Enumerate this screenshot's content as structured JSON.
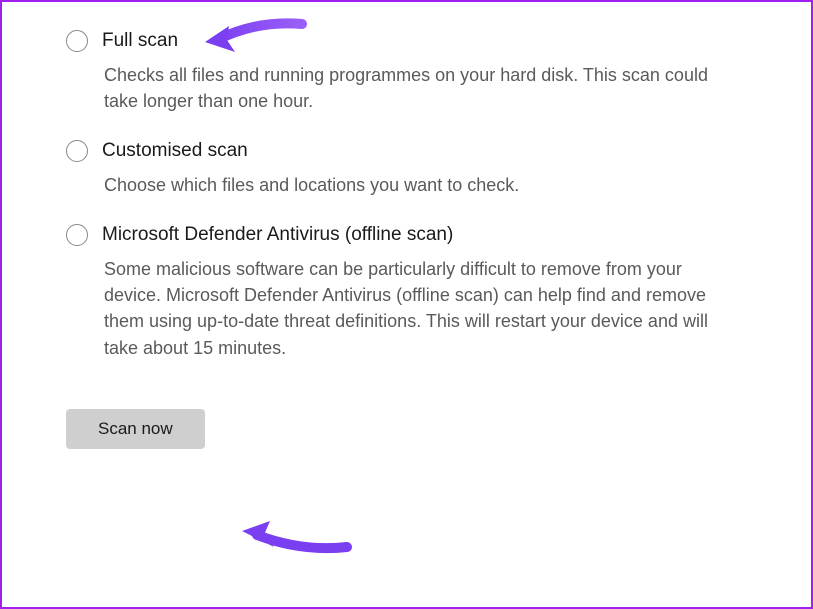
{
  "options": [
    {
      "title": "Full scan",
      "description": "Checks all files and running programmes on your hard disk. This scan could take longer than one hour."
    },
    {
      "title": "Customised scan",
      "description": "Choose which files and locations you want to check."
    },
    {
      "title": "Microsoft Defender Antivirus (offline scan)",
      "description": "Some malicious software can be particularly difficult to remove from your device. Microsoft Defender Antivirus (offline scan) can help find and remove them using up-to-date threat definitions. This will restart your device and will take about 15 minutes."
    }
  ],
  "button": {
    "label": "Scan now"
  },
  "annotation_color": "#7b3ff2"
}
